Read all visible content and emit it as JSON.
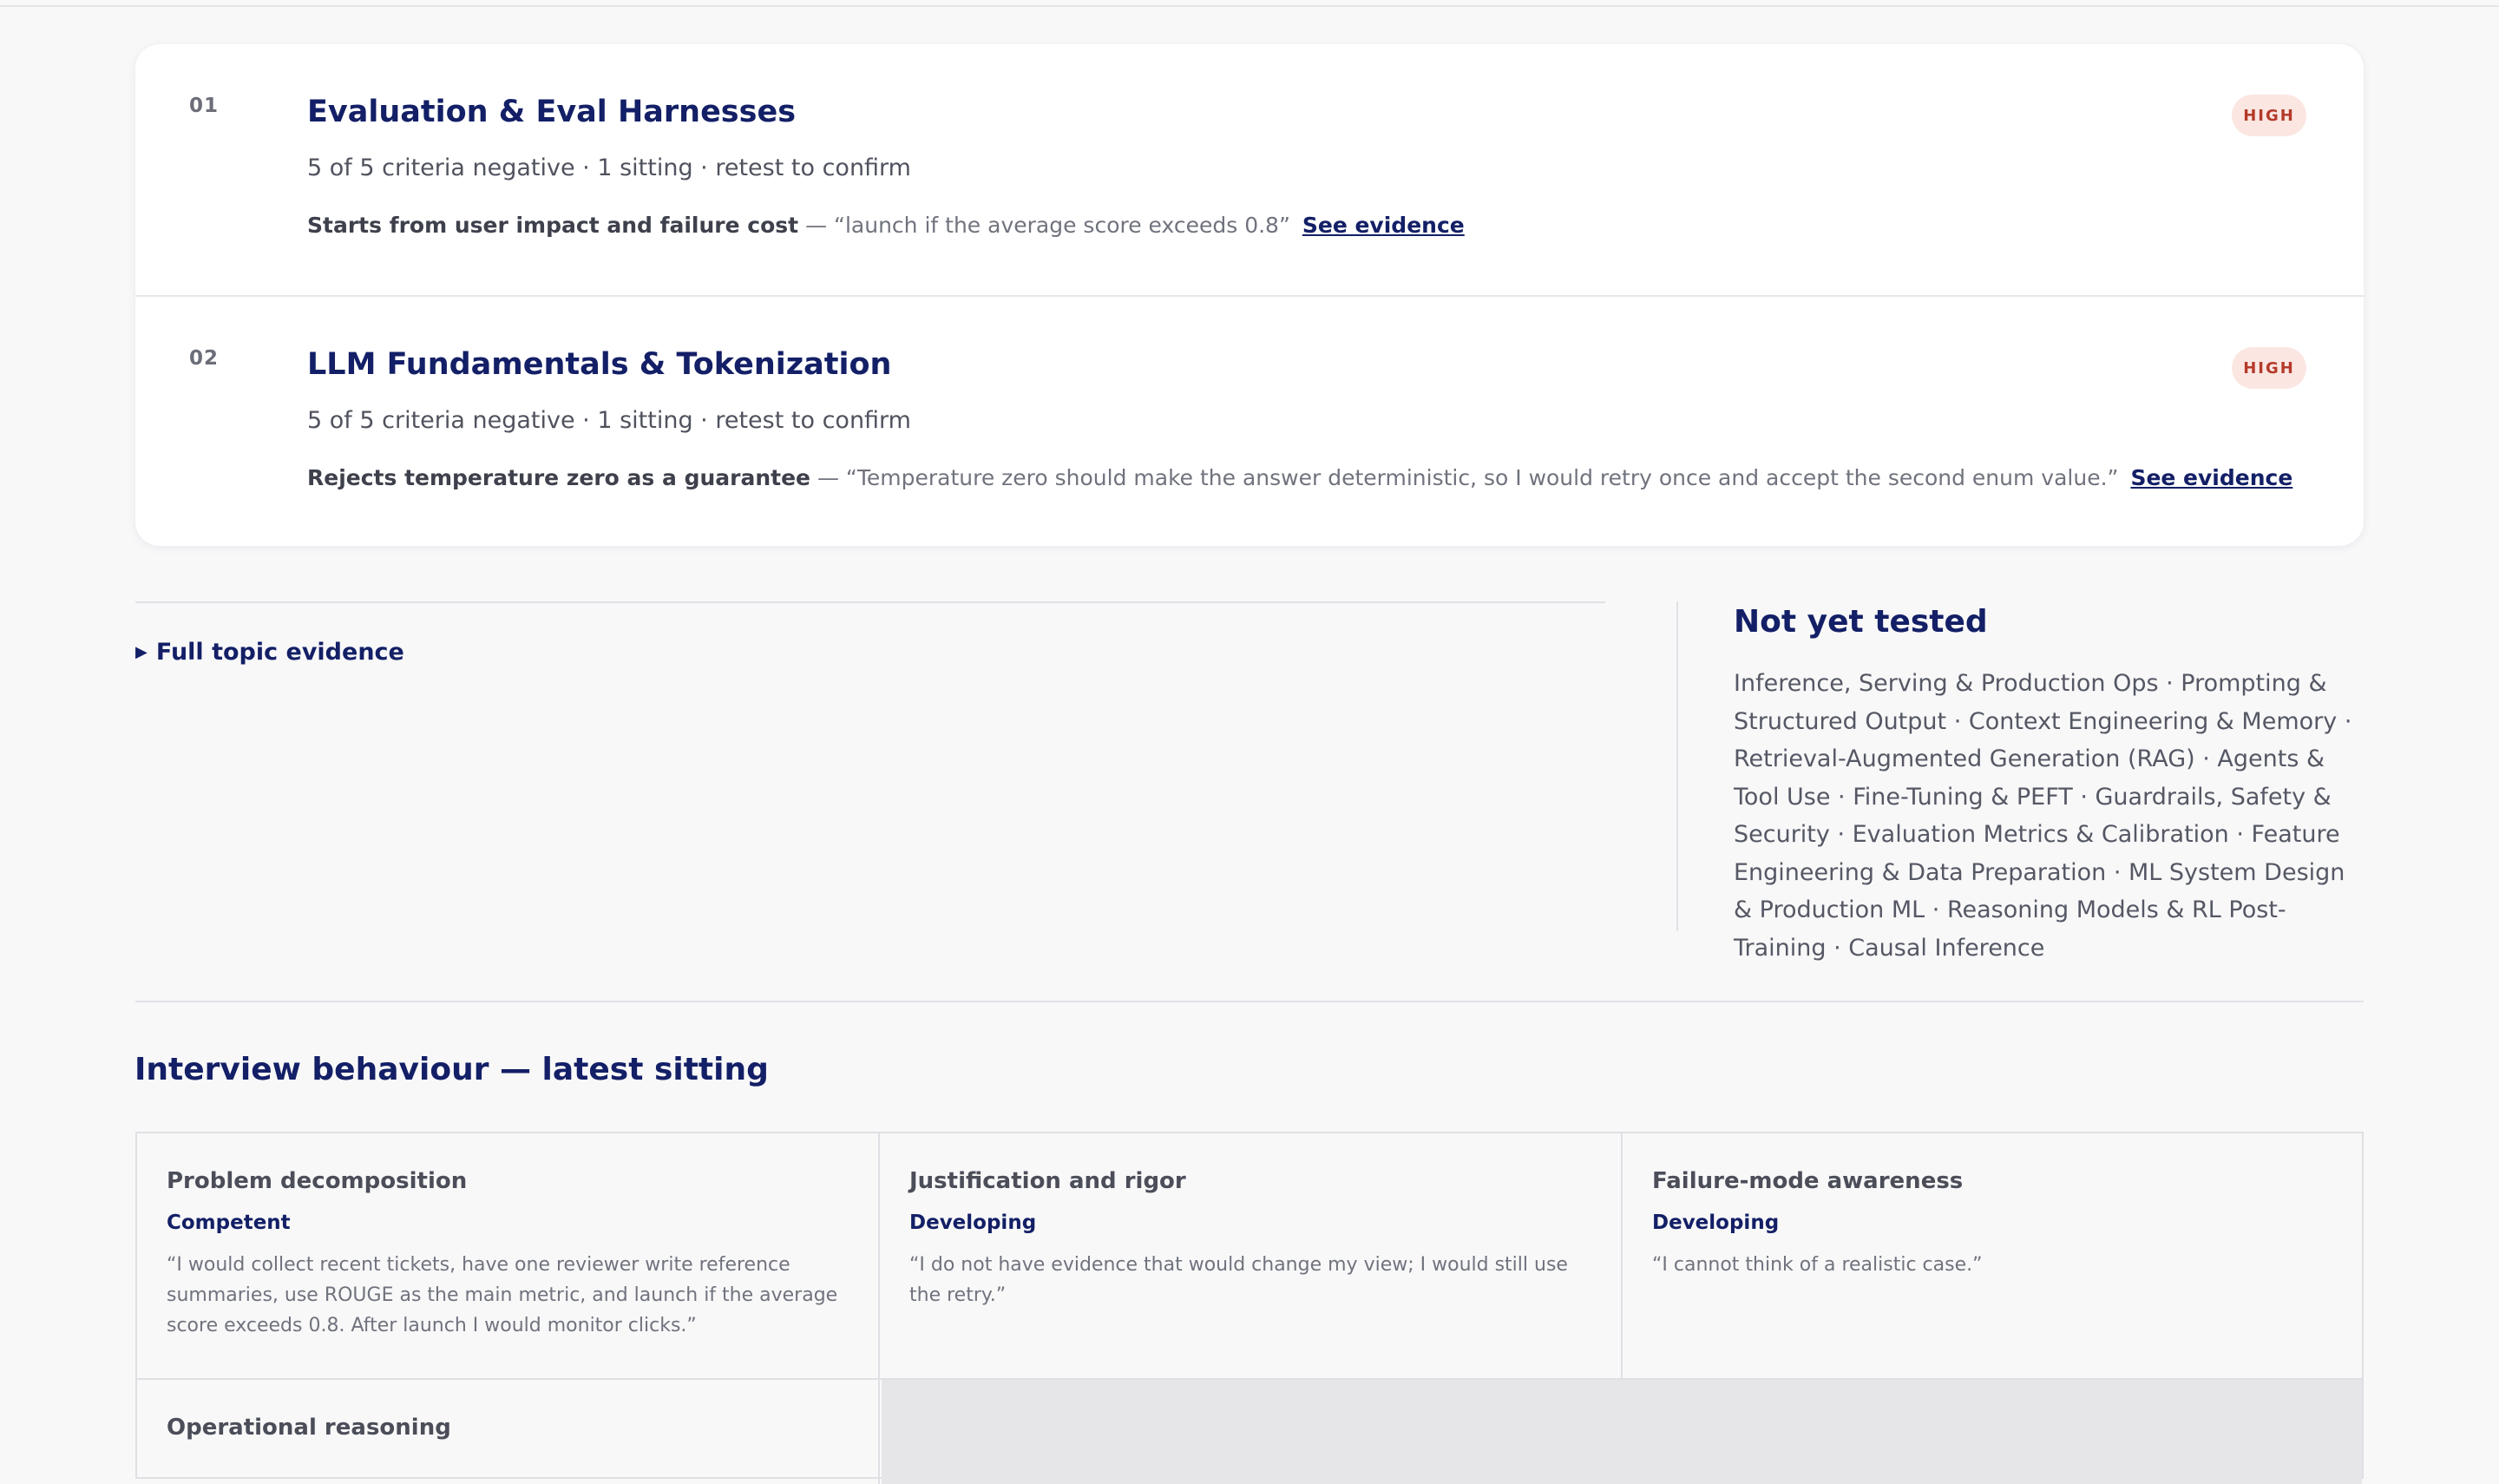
{
  "topics": [
    {
      "number": "01",
      "title": "Evaluation & Eval Harnesses",
      "meta": "5 of 5 criteria negative · 1 sitting · retest to confirm",
      "evidence_label": "Starts from user impact and failure cost",
      "evidence_quote": " — “launch if the average score exceeds 0.8”",
      "link": "See evidence",
      "badge": "HIGH"
    },
    {
      "number": "02",
      "title": "LLM Fundamentals & Tokenization",
      "meta": "5 of 5 criteria negative · 1 sitting · retest to confirm",
      "evidence_label": "Rejects temperature zero as a guarantee",
      "evidence_quote": " — “Temperature zero should make the answer deterministic, so I would retry once and accept the second enum value.”",
      "link": "See evidence",
      "badge": "HIGH"
    }
  ],
  "disclosure": {
    "label": "Full topic evidence"
  },
  "not_yet_tested": {
    "title": "Not yet tested",
    "items": "Inference, Serving & Production Ops · Prompting & Structured Output · Context Engineering & Memory · Retrieval-Augmented Generation (RAG) · Agents & Tool Use · Fine-Tuning & PEFT · Guardrails, Safety & Security · Evaluation Metrics & Calibration · Feature Engineering & Data Preparation · ML System Design & Production ML · Reasoning Models & RL Post-Training · Causal Inference"
  },
  "behaviour": {
    "title": "Interview behaviour — latest sitting",
    "cells": [
      {
        "title": "Problem decomposition",
        "level": "Competent",
        "quote": "“I would collect recent tickets, have one reviewer write reference summaries, use ROUGE as the main metric, and launch if the average score exceeds 0.8. After launch I would monitor clicks.”"
      },
      {
        "title": "Justification and rigor",
        "level": "Developing",
        "quote": "“I do not have evidence that would change my view; I would still use the retry.”"
      },
      {
        "title": "Failure-mode awareness",
        "level": "Developing",
        "quote": "“I cannot think of a realistic case.”"
      },
      {
        "title": "Operational reasoning"
      }
    ]
  },
  "colors": {
    "heading": "#131f66",
    "badge_bg": "#fbe6e2",
    "badge_text": "#b43a2a",
    "page_bg": "#f8f8f9"
  },
  "icons": {
    "disclosure": "triangle-right-icon"
  }
}
